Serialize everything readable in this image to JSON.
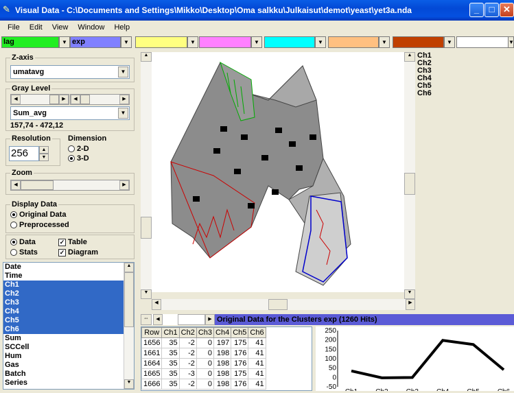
{
  "window": {
    "title": "Visual Data - C:\\Documents and Settings\\Mikko\\Desktop\\Oma salkku\\Julkaisut\\demot\\yeast\\yet3a.nda"
  },
  "menu": [
    "File",
    "Edit",
    "View",
    "Window",
    "Help"
  ],
  "colorbar": {
    "boxes": [
      {
        "label": "lag",
        "color": "#22ee22"
      },
      {
        "label": "exp",
        "color": "#8080ff"
      },
      {
        "label": "",
        "color": "#ffff80"
      },
      {
        "label": "",
        "color": "#ff80ff"
      },
      {
        "label": "",
        "color": "#00ffff"
      },
      {
        "label": "",
        "color": "#ffc080"
      },
      {
        "label": "",
        "color": "#c04000"
      },
      {
        "label": "",
        "color": "#ffffff"
      }
    ]
  },
  "left": {
    "zaxis_title": "Z-axis",
    "zaxis_value": "umatavg",
    "gray_title": "Gray Level",
    "gray_value": "Sum_avg",
    "gray_range": "157,74 - 472,12",
    "resolution_title": "Resolution",
    "resolution_value": "256",
    "dimension_title": "Dimension",
    "dim_2d": "2-D",
    "dim_3d": "3-D",
    "zoom_title": "Zoom",
    "display_title": "Display Data",
    "original": "Original Data",
    "preprocessed": "Preprocessed",
    "data": "Data",
    "stats": "Stats",
    "table": "Table",
    "diagram": "Diagram"
  },
  "variables": [
    {
      "name": "Date",
      "selected": false
    },
    {
      "name": "Time",
      "selected": false
    },
    {
      "name": "Ch1",
      "selected": true
    },
    {
      "name": "Ch2",
      "selected": true
    },
    {
      "name": "Ch3",
      "selected": true
    },
    {
      "name": "Ch4",
      "selected": true
    },
    {
      "name": "Ch5",
      "selected": true
    },
    {
      "name": "Ch6",
      "selected": true
    },
    {
      "name": "Sum",
      "selected": false
    },
    {
      "name": "SCCell",
      "selected": false
    },
    {
      "name": "Hum",
      "selected": false
    },
    {
      "name": "Gas",
      "selected": false
    },
    {
      "name": "Batch",
      "selected": false
    },
    {
      "name": "Series",
      "selected": false
    }
  ],
  "channels": [
    "Ch1",
    "Ch2",
    "Ch3",
    "Ch4",
    "Ch5",
    "Ch6"
  ],
  "status": {
    "cluster_title": "Original Data for the Clusters exp (1260 Hits)"
  },
  "table": {
    "headers": [
      "Row",
      "Ch1",
      "Ch2",
      "Ch3",
      "Ch4",
      "Ch5",
      "Ch6"
    ],
    "rows": [
      [
        "1656",
        "35",
        "-2",
        "0",
        "197",
        "175",
        "41"
      ],
      [
        "1661",
        "35",
        "-2",
        "0",
        "198",
        "176",
        "41"
      ],
      [
        "1664",
        "35",
        "-2",
        "0",
        "198",
        "176",
        "41"
      ],
      [
        "1665",
        "35",
        "-3",
        "0",
        "198",
        "175",
        "41"
      ],
      [
        "1666",
        "35",
        "-2",
        "0",
        "198",
        "176",
        "41"
      ]
    ]
  },
  "chart_data": {
    "type": "line",
    "categories": [
      "Ch1",
      "Ch2",
      "Ch3",
      "Ch4",
      "Ch5",
      "Ch6"
    ],
    "series": [
      {
        "values": [
          35,
          -2,
          0,
          198,
          176,
          41
        ]
      }
    ],
    "yticks": [
      250,
      200,
      150,
      100,
      50,
      0,
      -50
    ],
    "ylim": [
      -50,
      250
    ]
  }
}
